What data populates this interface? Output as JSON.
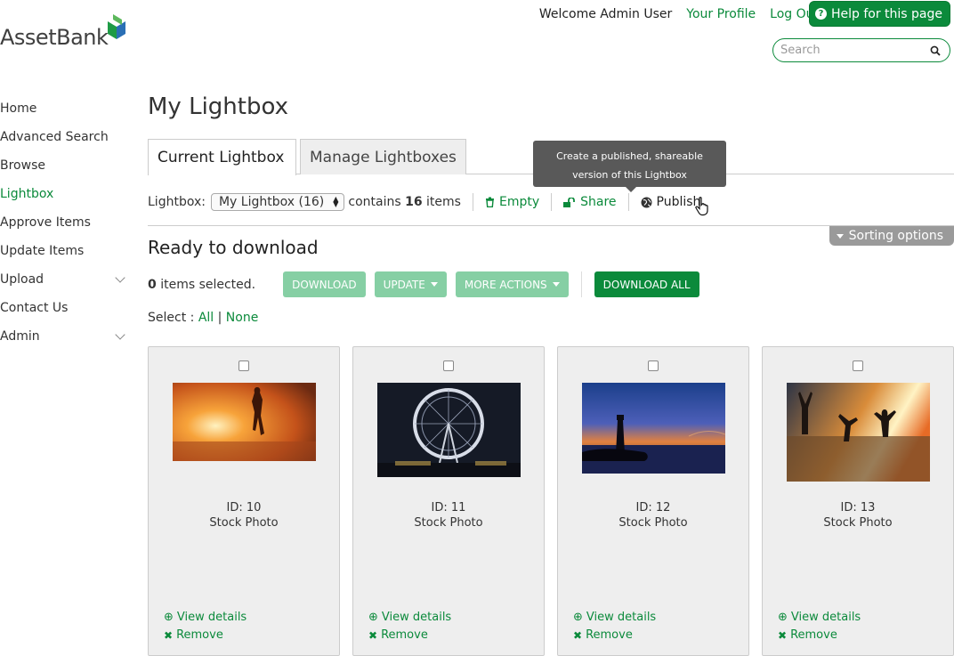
{
  "header": {
    "logo_text": "AssetBank",
    "welcome": "Welcome Admin User",
    "your_profile": "Your Profile",
    "log_out": "Log Out",
    "help": "Help for this page",
    "search_placeholder": "Search"
  },
  "sidebar": {
    "items": [
      {
        "label": "Home"
      },
      {
        "label": "Advanced Search"
      },
      {
        "label": "Browse"
      },
      {
        "label": "Lightbox"
      },
      {
        "label": "Approve Items"
      },
      {
        "label": "Update Items"
      },
      {
        "label": "Upload"
      },
      {
        "label": "Contact Us"
      },
      {
        "label": "Admin"
      }
    ]
  },
  "main": {
    "title": "My Lightbox",
    "tabs": [
      {
        "label": "Current Lightbox"
      },
      {
        "label": "Manage Lightboxes"
      }
    ],
    "tooltip": "Create a published, shareable version of this Lightbox",
    "lightbox_label": "Lightbox:",
    "lightbox_value": "My Lightbox (16)",
    "contains_prefix": "contains",
    "contains_count": "16",
    "contains_suffix": "items",
    "empty": "Empty",
    "share": "Share",
    "publish": "Publish",
    "sorting_options": "Sorting options",
    "ready_title": "Ready to download",
    "selected_count": "0",
    "selected_suffix": "items selected.",
    "btn_download": "DOWNLOAD",
    "btn_update": "UPDATE",
    "btn_more_actions": "MORE ACTIONS",
    "btn_download_all": "DOWNLOAD ALL",
    "select_label": "Select :",
    "select_all": "All",
    "select_sep": "|",
    "select_none": "None"
  },
  "cards": [
    {
      "id": "ID: 10",
      "type": "Stock Photo",
      "view": "View details",
      "remove": "Remove"
    },
    {
      "id": "ID: 11",
      "type": "Stock Photo",
      "view": "View details",
      "remove": "Remove"
    },
    {
      "id": "ID: 12",
      "type": "Stock Photo",
      "view": "View details",
      "remove": "Remove"
    },
    {
      "id": "ID: 13",
      "type": "Stock Photo",
      "view": "View details",
      "remove": "Remove"
    }
  ],
  "colors": {
    "accent": "#0b8a3b",
    "accent_light": "#86cfa4",
    "card_bg": "#eeeeee"
  }
}
